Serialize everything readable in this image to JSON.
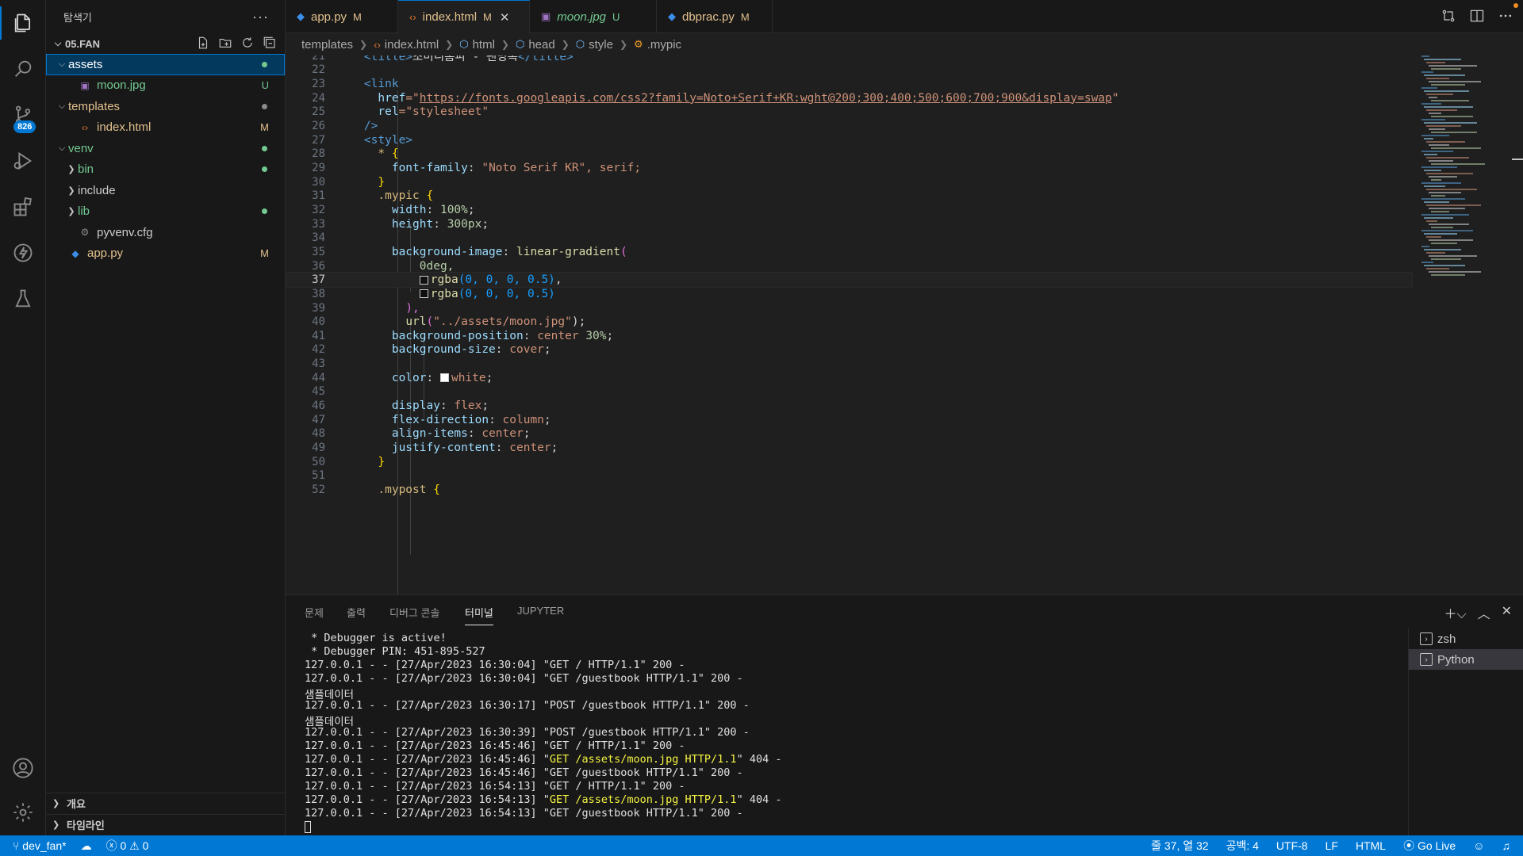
{
  "sidebar": {
    "title": "탐색기",
    "more": "···",
    "root": "05.FAN",
    "tree": [
      {
        "label": "assets",
        "status": "",
        "dot": "#73c991",
        "kind": "folder-open",
        "color": "#ffffff"
      },
      {
        "label": "moon.jpg",
        "status": "U",
        "kind": "image",
        "color": "#73c991"
      },
      {
        "label": "templates",
        "status": "",
        "dot": "#8b8b8b",
        "kind": "folder-open",
        "color": "#e2c08d"
      },
      {
        "label": "index.html",
        "status": "M",
        "kind": "html",
        "color": "#e2c08d"
      },
      {
        "label": "venv",
        "status": "",
        "dot": "#73c991",
        "kind": "folder-open",
        "color": "#73c991"
      },
      {
        "label": "bin",
        "status": "",
        "dot": "#73c991",
        "kind": "folder",
        "color": "#73c991"
      },
      {
        "label": "include",
        "status": "",
        "kind": "folder",
        "color": "#cccccc"
      },
      {
        "label": "lib",
        "status": "",
        "dot": "#73c991",
        "kind": "folder",
        "color": "#73c991"
      },
      {
        "label": "pyvenv.cfg",
        "status": "",
        "kind": "gear",
        "color": "#cccccc"
      },
      {
        "label": "app.py",
        "status": "M",
        "kind": "python",
        "color": "#e2c08d"
      }
    ],
    "outline": "개요",
    "timeline": "타임라인"
  },
  "tabs": [
    {
      "label": "app.py",
      "mark": "M",
      "icon": "python"
    },
    {
      "label": "index.html",
      "mark": "M",
      "icon": "html"
    },
    {
      "label": "moon.jpg",
      "mark": "U",
      "icon": "image"
    },
    {
      "label": "dbprac.py",
      "mark": "M",
      "icon": "python"
    }
  ],
  "breadcrumb": [
    "templates",
    "index.html",
    "html",
    "head",
    "style",
    ".mypic"
  ],
  "activity": {
    "badge": "826"
  },
  "editor": {
    "current_line": 37,
    "lines": [
      21,
      22,
      23,
      24,
      25,
      26,
      27,
      28,
      29,
      30,
      31,
      32,
      33,
      34,
      35,
      36,
      37,
      38,
      39,
      40,
      41,
      42,
      43,
      44,
      45,
      46,
      47,
      48,
      49,
      50,
      51,
      52
    ]
  },
  "code": {
    "l21_open": "<title>",
    "l21_text": "초미니홈피 - 팬명록",
    "l21_close": "</title>",
    "l23": "<link",
    "l24_attr": "href",
    "l24_eq": "=\"",
    "l24_url": "https://fonts.googleapis.com/css2?family=Noto+Serif+KR:wght@200;300;400;500;600;700;900&display=swap",
    "l24_end": "\"",
    "l25_attr": "rel",
    "l25_val": "=\"stylesheet\"",
    "l26": "/>",
    "l27": "<style>",
    "l28_sel": "* ",
    "l28_br": "{",
    "l29_prop": "font-family",
    "l29_val": "\"Noto Serif KR\"",
    "l29_rest": ", serif;",
    "l30": "}",
    "l31_sel": ".mypic ",
    "l31_br": "{",
    "l32_prop": "width",
    "l32_val": "100%",
    "l32_end": ";",
    "l33_prop": "height",
    "l33_val": "300px",
    "l33_end": ";",
    "l35_prop": "background-image",
    "l35_fn": "linear-gradient",
    "l35_br": "(",
    "l36": "0deg,",
    "l37_fn": "rgba",
    "l37_args": "(0, 0, 0, 0.5)",
    "l37_end": ",",
    "l38_fn": "rgba",
    "l38_args": "(0, 0, 0, 0.5)",
    "l39": "),",
    "l40_fn": "url",
    "l40_arg": "\"../assets/moon.jpg\"",
    "l40_end": ");",
    "l41_prop": "background-position",
    "l41_val": "center",
    "l41_num": "30%",
    "l41_end": ";",
    "l42_prop": "background-size",
    "l42_val": "cover",
    "l42_end": ";",
    "l44_prop": "color",
    "l44_val": "white",
    "l44_end": ";",
    "l46_prop": "display",
    "l46_val": "flex",
    "l46_end": ";",
    "l47_prop": "flex-direction",
    "l47_val": "column",
    "l47_end": ";",
    "l48_prop": "align-items",
    "l48_val": "center",
    "l48_end": ";",
    "l49_prop": "justify-content",
    "l49_val": "center",
    "l49_end": ";",
    "l50": "}",
    "l52_sel": ".mypost ",
    "l52_br": "{"
  },
  "panel": {
    "tabs": [
      "문제",
      "출력",
      "디버그 콘솔",
      "터미널",
      "JUPYTER"
    ],
    "active_tab": "터미널",
    "terminals": [
      "zsh",
      "Python"
    ],
    "lines": [
      {
        "text": " * Debugger is active!"
      },
      {
        "text": " * Debugger PIN: 451-895-527"
      },
      {
        "text": "127.0.0.1 - - [27/Apr/2023 16:30:04] \"GET / HTTP/1.1\" 200 -"
      },
      {
        "text": "127.0.0.1 - - [27/Apr/2023 16:30:04] \"GET /guestbook HTTP/1.1\" 200 -"
      },
      {
        "text": "샘플데이터"
      },
      {
        "text": "127.0.0.1 - - [27/Apr/2023 16:30:17] \"POST /guestbook HTTP/1.1\" 200 -"
      },
      {
        "text": "샘플데이터"
      },
      {
        "text": "127.0.0.1 - - [27/Apr/2023 16:30:39] \"POST /guestbook HTTP/1.1\" 200 -"
      },
      {
        "text": "127.0.0.1 - - [27/Apr/2023 16:45:46] \"GET / HTTP/1.1\" 200 -"
      },
      {
        "pre": "127.0.0.1 - - [27/Apr/2023 16:45:46] \"",
        "hl": "GET /assets/moon.jpg HTTP/1.1",
        "post": "\" 404 -"
      },
      {
        "text": "127.0.0.1 - - [27/Apr/2023 16:45:46] \"GET /guestbook HTTP/1.1\" 200 -"
      },
      {
        "text": "127.0.0.1 - - [27/Apr/2023 16:54:13] \"GET / HTTP/1.1\" 200 -"
      },
      {
        "pre": "127.0.0.1 - - [27/Apr/2023 16:54:13] \"",
        "hl": "GET /assets/moon.jpg HTTP/1.1",
        "post": "\" 404 -"
      },
      {
        "text": "127.0.0.1 - - [27/Apr/2023 16:54:13] \"GET /guestbook HTTP/1.1\" 200 -"
      }
    ]
  },
  "statusbar": {
    "branch": "dev_fan*",
    "errors": "0",
    "warnings": "0",
    "position": "줄 37, 열 32",
    "spaces": "공백: 4",
    "encoding": "UTF-8",
    "eol": "LF",
    "language": "HTML",
    "golive": "Go Live"
  },
  "colors": {
    "accent": "#0078d4",
    "statusbar": "#0078d4",
    "untracked": "#73c991",
    "modified": "#e2c08d"
  }
}
